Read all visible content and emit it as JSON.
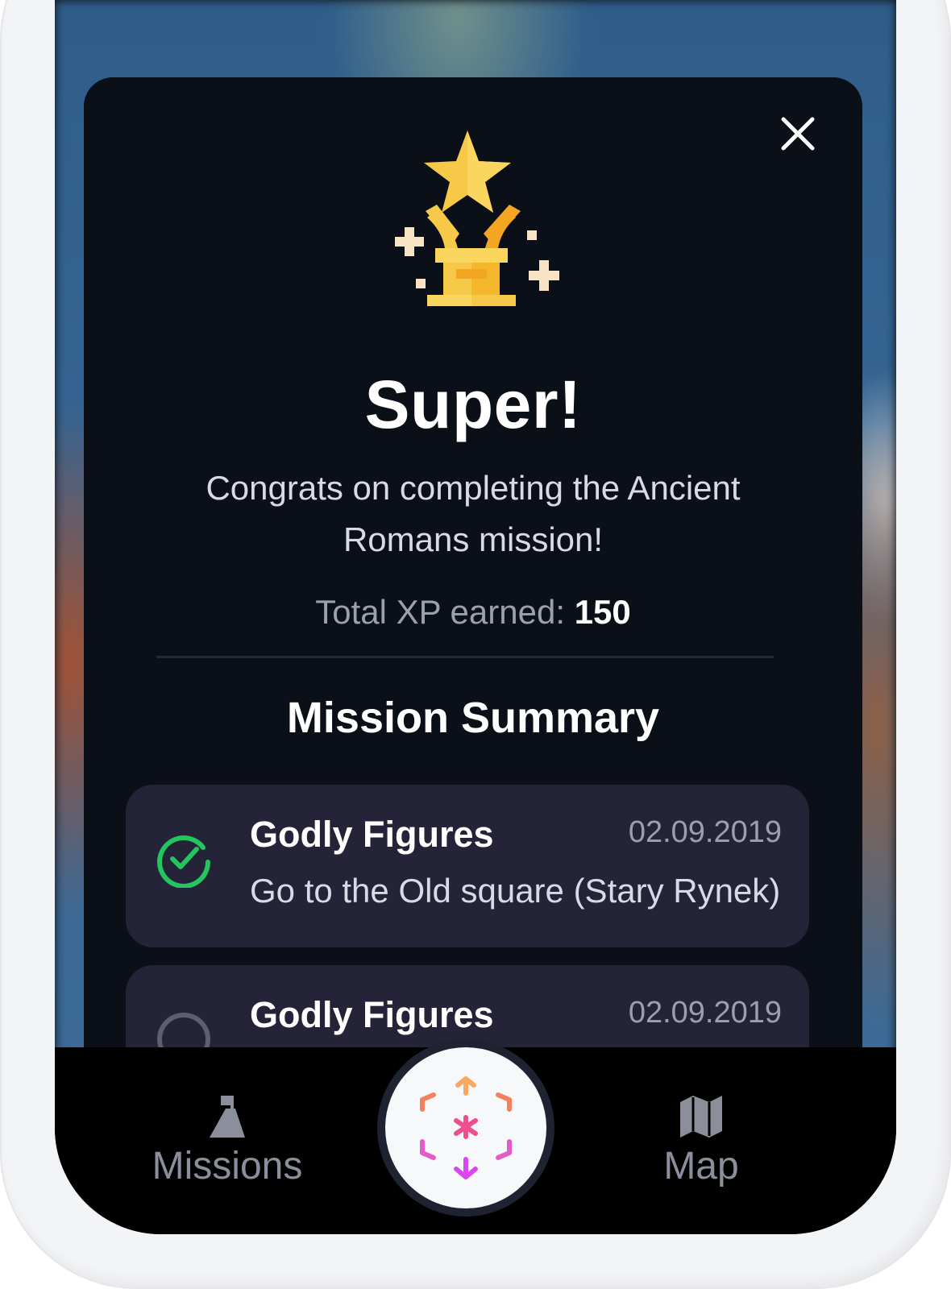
{
  "modal": {
    "close_icon": "close-icon",
    "trophy_icon": "trophy-star-icon",
    "title": "Super!",
    "subtitle": "Congrats on completing the Ancient Romans mission!",
    "xp_label": "Total XP earned: ",
    "xp_value": "150",
    "summary_title": "Mission Summary"
  },
  "missions": [
    {
      "title": "Godly Figures",
      "date": "02.09.2019",
      "description": "Go to the Old square (Stary Rynek)",
      "status": "completed",
      "status_icon": "check-circle-icon",
      "status_color": "#22c55e"
    },
    {
      "title": "Godly Figures",
      "date": "02.09.2019",
      "status": "incomplete",
      "status_icon": "empty-circle-icon"
    }
  ],
  "bottom_nav": {
    "missions_label": "Missions",
    "missions_icon": "mountain-flag-icon",
    "map_label": "Map",
    "map_icon": "map-icon",
    "center_icon": "ar-cube-icon"
  },
  "colors": {
    "accent_gold": "#f7c948",
    "success_green": "#22c55e",
    "card_bg": "#252338",
    "modal_bg": "#0b0f17"
  }
}
